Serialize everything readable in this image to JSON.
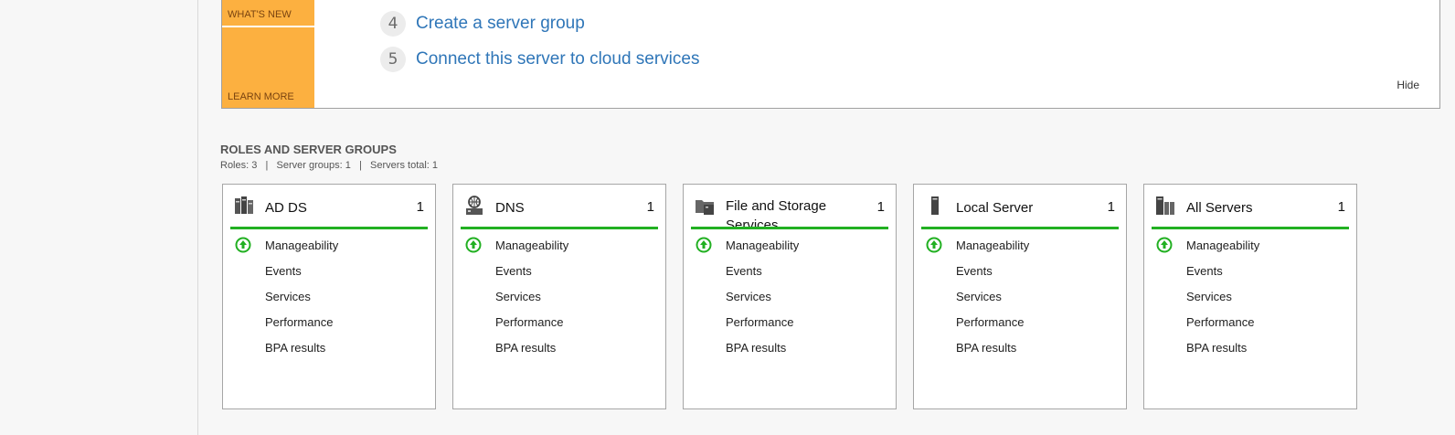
{
  "welcome": {
    "whats_new": "WHAT'S NEW",
    "learn_more": "LEARN MORE",
    "steps": [
      {
        "num": "4",
        "label": "Create a server group"
      },
      {
        "num": "5",
        "label": "Connect this server to cloud services"
      }
    ],
    "hide": "Hide"
  },
  "roles": {
    "title": "ROLES AND SERVER GROUPS",
    "summary": "Roles: 3   |   Server groups: 1   |   Servers total: 1"
  },
  "tiles": [
    {
      "name": "AD DS",
      "count": "1",
      "icon": "ad-ds-icon"
    },
    {
      "name": "DNS",
      "count": "1",
      "icon": "dns-icon"
    },
    {
      "name": "File and Storage Services",
      "count": "1",
      "icon": "file-storage-icon"
    },
    {
      "name": "Local Server",
      "count": "1",
      "icon": "server-icon"
    },
    {
      "name": "All Servers",
      "count": "1",
      "icon": "servers-icon"
    }
  ],
  "tile_rows": [
    "Manageability",
    "Events",
    "Services",
    "Performance",
    "BPA results"
  ],
  "colors": {
    "accent": "#2f76b8",
    "status_ok": "#22b022",
    "orange": "#fcb040"
  }
}
